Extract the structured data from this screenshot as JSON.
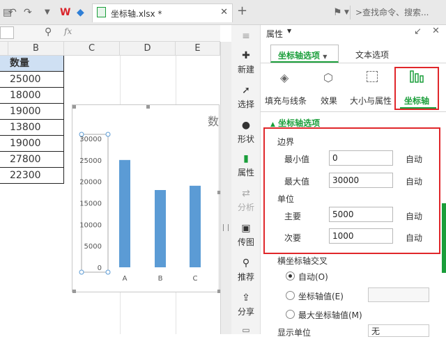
{
  "title_tab": {
    "filename": "坐标轴.xlsx *"
  },
  "search": {
    "placeholder": ">查找命令、搜索..."
  },
  "formula": {
    "fx": "fx"
  },
  "sheet": {
    "columns": [
      "B",
      "C",
      "D",
      "E"
    ],
    "header_cell": "数量",
    "values": [
      "25000",
      "18000",
      "19000",
      "13800",
      "19000",
      "27800",
      "22300"
    ]
  },
  "chart_data": {
    "type": "bar",
    "title": "数",
    "categories": [
      "A",
      "B",
      "C"
    ],
    "values": [
      25000,
      18000,
      19000
    ],
    "ylim": [
      0,
      30000
    ],
    "yticks": [
      "30000",
      "25000",
      "20000",
      "15000",
      "10000",
      "5000",
      "0"
    ],
    "bar_color": "#5b9bd5"
  },
  "sidebar": {
    "items": [
      "新建",
      "选择",
      "形状",
      "属性",
      "分析",
      "传图",
      "推荐",
      "分享"
    ]
  },
  "panel": {
    "title": "属性",
    "tabs": [
      "坐标轴选项",
      "文本选项"
    ],
    "tools": [
      "填充与线条",
      "效果",
      "大小与属性",
      "坐标轴"
    ],
    "section": "坐标轴选项",
    "bounds_label": "边界",
    "min_label": "最小值",
    "min_value": "0",
    "max_label": "最大值",
    "max_value": "30000",
    "unit_label": "单位",
    "major_label": "主要",
    "major_value": "5000",
    "minor_label": "次要",
    "minor_value": "1000",
    "auto": "自动",
    "cross_label": "横坐标轴交叉",
    "radio_auto": "自动(O)",
    "radio_value": "坐标轴值(E)",
    "radio_max": "最大坐标轴值(M)",
    "display_unit": "显示单位",
    "display_value": "无"
  },
  "colors": {
    "accent": "#1a9e3a",
    "highlight": "#e0262a",
    "header_fill": "#cfe0f3"
  }
}
